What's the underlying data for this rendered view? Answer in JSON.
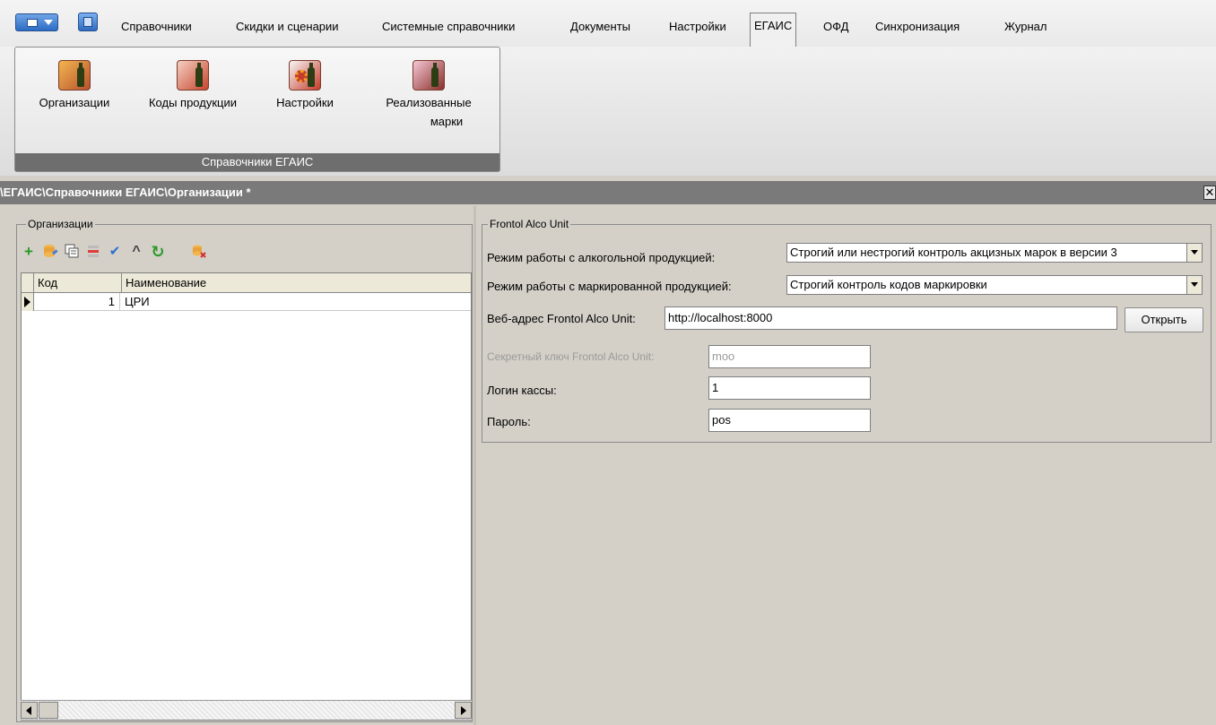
{
  "menu": {
    "tabs": [
      "Справочники",
      "Скидки и сценарии",
      "Системные справочники",
      "Документы",
      "Настройки",
      "ЕГАИС",
      "ОФД",
      "Синхронизация",
      "Журнал"
    ],
    "active_tab": "ЕГАИС"
  },
  "ribbon": {
    "group_label": "Справочники ЕГАИС",
    "buttons": [
      {
        "label": "Организации",
        "icon": "organizations-icon"
      },
      {
        "label": "Коды продукции",
        "icon": "product-codes-icon"
      },
      {
        "label": "Настройки",
        "icon": "settings-icon"
      },
      {
        "label": "Реализованные марки",
        "label_line1": "Реализованные",
        "label_line2": "марки",
        "icon": "sold-marks-icon"
      }
    ]
  },
  "path": "\\ЕГАИС\\Справочники ЕГАИС\\Организации *",
  "organizations": {
    "group_title": "Организации",
    "toolbar": [
      "add-icon",
      "edit-icon",
      "copy-icon",
      "delete-icon",
      "move-down-icon",
      "move-up-icon",
      "refresh-icon",
      "clear-icon"
    ],
    "columns": [
      "Код",
      "Наименование"
    ],
    "rows": [
      {
        "code": "1",
        "name": "ЦРИ"
      }
    ]
  },
  "fau": {
    "group_title": "Frontol Alco Unit",
    "alco_mode_label": "Режим работы с алкогольной продукцией:",
    "alco_mode_value": "Строгий или нестрогий контроль акцизных марок в версии 3",
    "marked_mode_label": "Режим работы с маркированной продукцией:",
    "marked_mode_value": "Строгий контроль кодов маркировки",
    "url_label": "Веб-адрес Frontol Alco Unit:",
    "url_value": "http://localhost:8000",
    "open_button": "Открыть",
    "secret_label": "Секретный ключ  Frontol Alco Unit:",
    "secret_value": "moo",
    "login_label": "Логин кассы:",
    "login_value": "1",
    "password_label": "Пароль:",
    "password_value": "pos"
  }
}
